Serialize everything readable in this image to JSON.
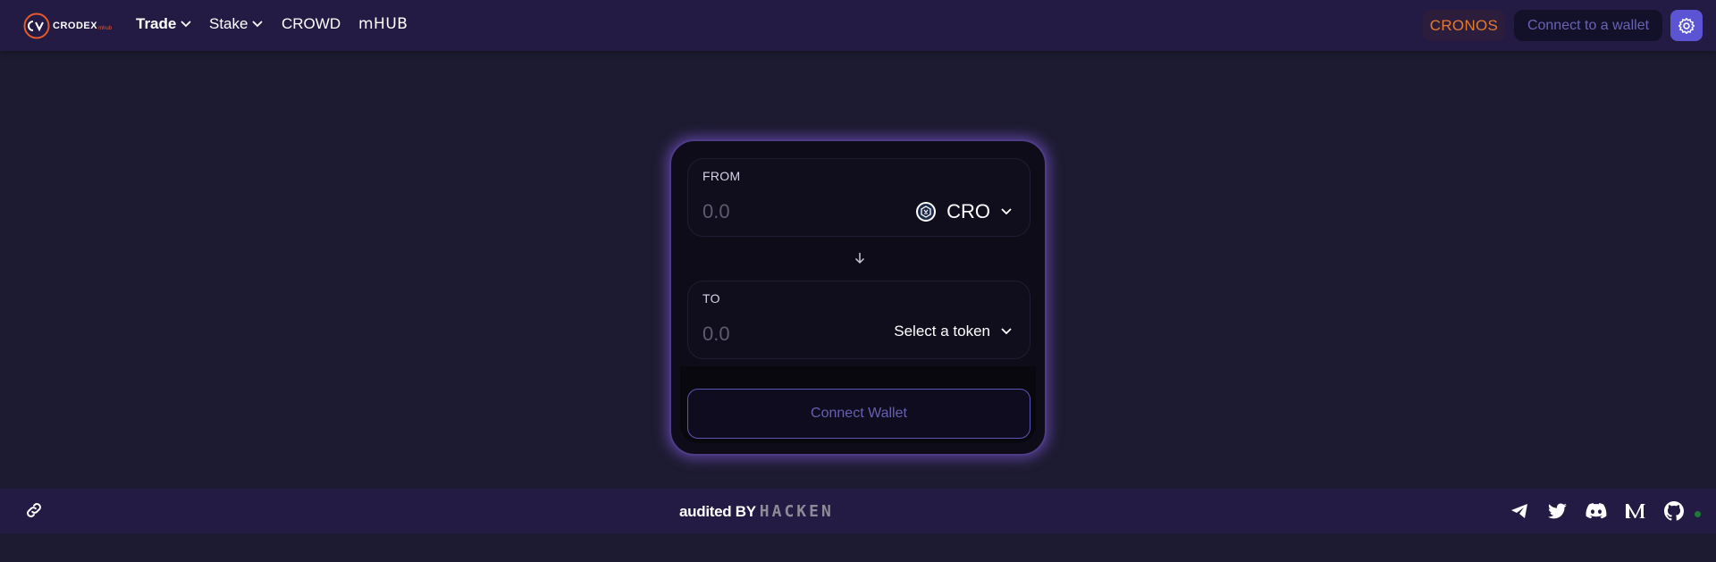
{
  "header": {
    "logo_text": "CRODEX",
    "logo_sub": "mhub",
    "nav": {
      "trade": "Trade",
      "stake": "Stake",
      "crowd": "CROWD",
      "mhub": "mHUB"
    },
    "network_label": "CRONOS",
    "connect_wallet_label": "Connect to a wallet"
  },
  "swap": {
    "from": {
      "label": "FROM",
      "amount_placeholder": "0.0",
      "token": "CRO"
    },
    "to": {
      "label": "TO",
      "amount_placeholder": "0.0",
      "token_placeholder": "Select a token"
    },
    "connect_button": "Connect Wallet"
  },
  "footer": {
    "audited_by": "audited BY",
    "auditor": "HACKEN",
    "socials": [
      "telegram-icon",
      "twitter-icon",
      "discord-icon",
      "medium-icon",
      "github-icon"
    ]
  },
  "colors": {
    "accent": "#5b55d4",
    "network": "#e07b36",
    "background": "#1d1b31",
    "header": "#231b43"
  }
}
